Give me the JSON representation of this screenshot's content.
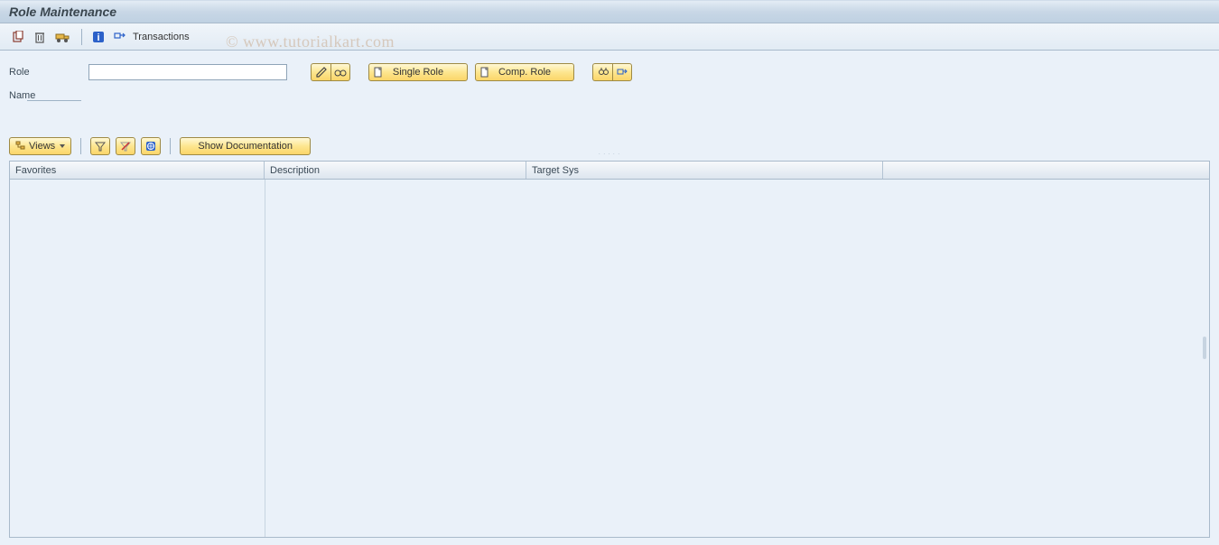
{
  "header": {
    "title": "Role Maintenance"
  },
  "app_toolbar": {
    "transactions_label": "Transactions"
  },
  "form": {
    "role_label": "Role",
    "role_value": "",
    "name_label": "Name",
    "single_role_label": "Single Role",
    "comp_role_label": "Comp. Role"
  },
  "views_toolbar": {
    "views_label": "Views",
    "show_docs_label": "Show Documentation"
  },
  "table": {
    "columns": {
      "favorites": "Favorites",
      "description": "Description",
      "target_sys": "Target Sys"
    },
    "rows": []
  },
  "watermark": "© www.tutorialkart.com"
}
